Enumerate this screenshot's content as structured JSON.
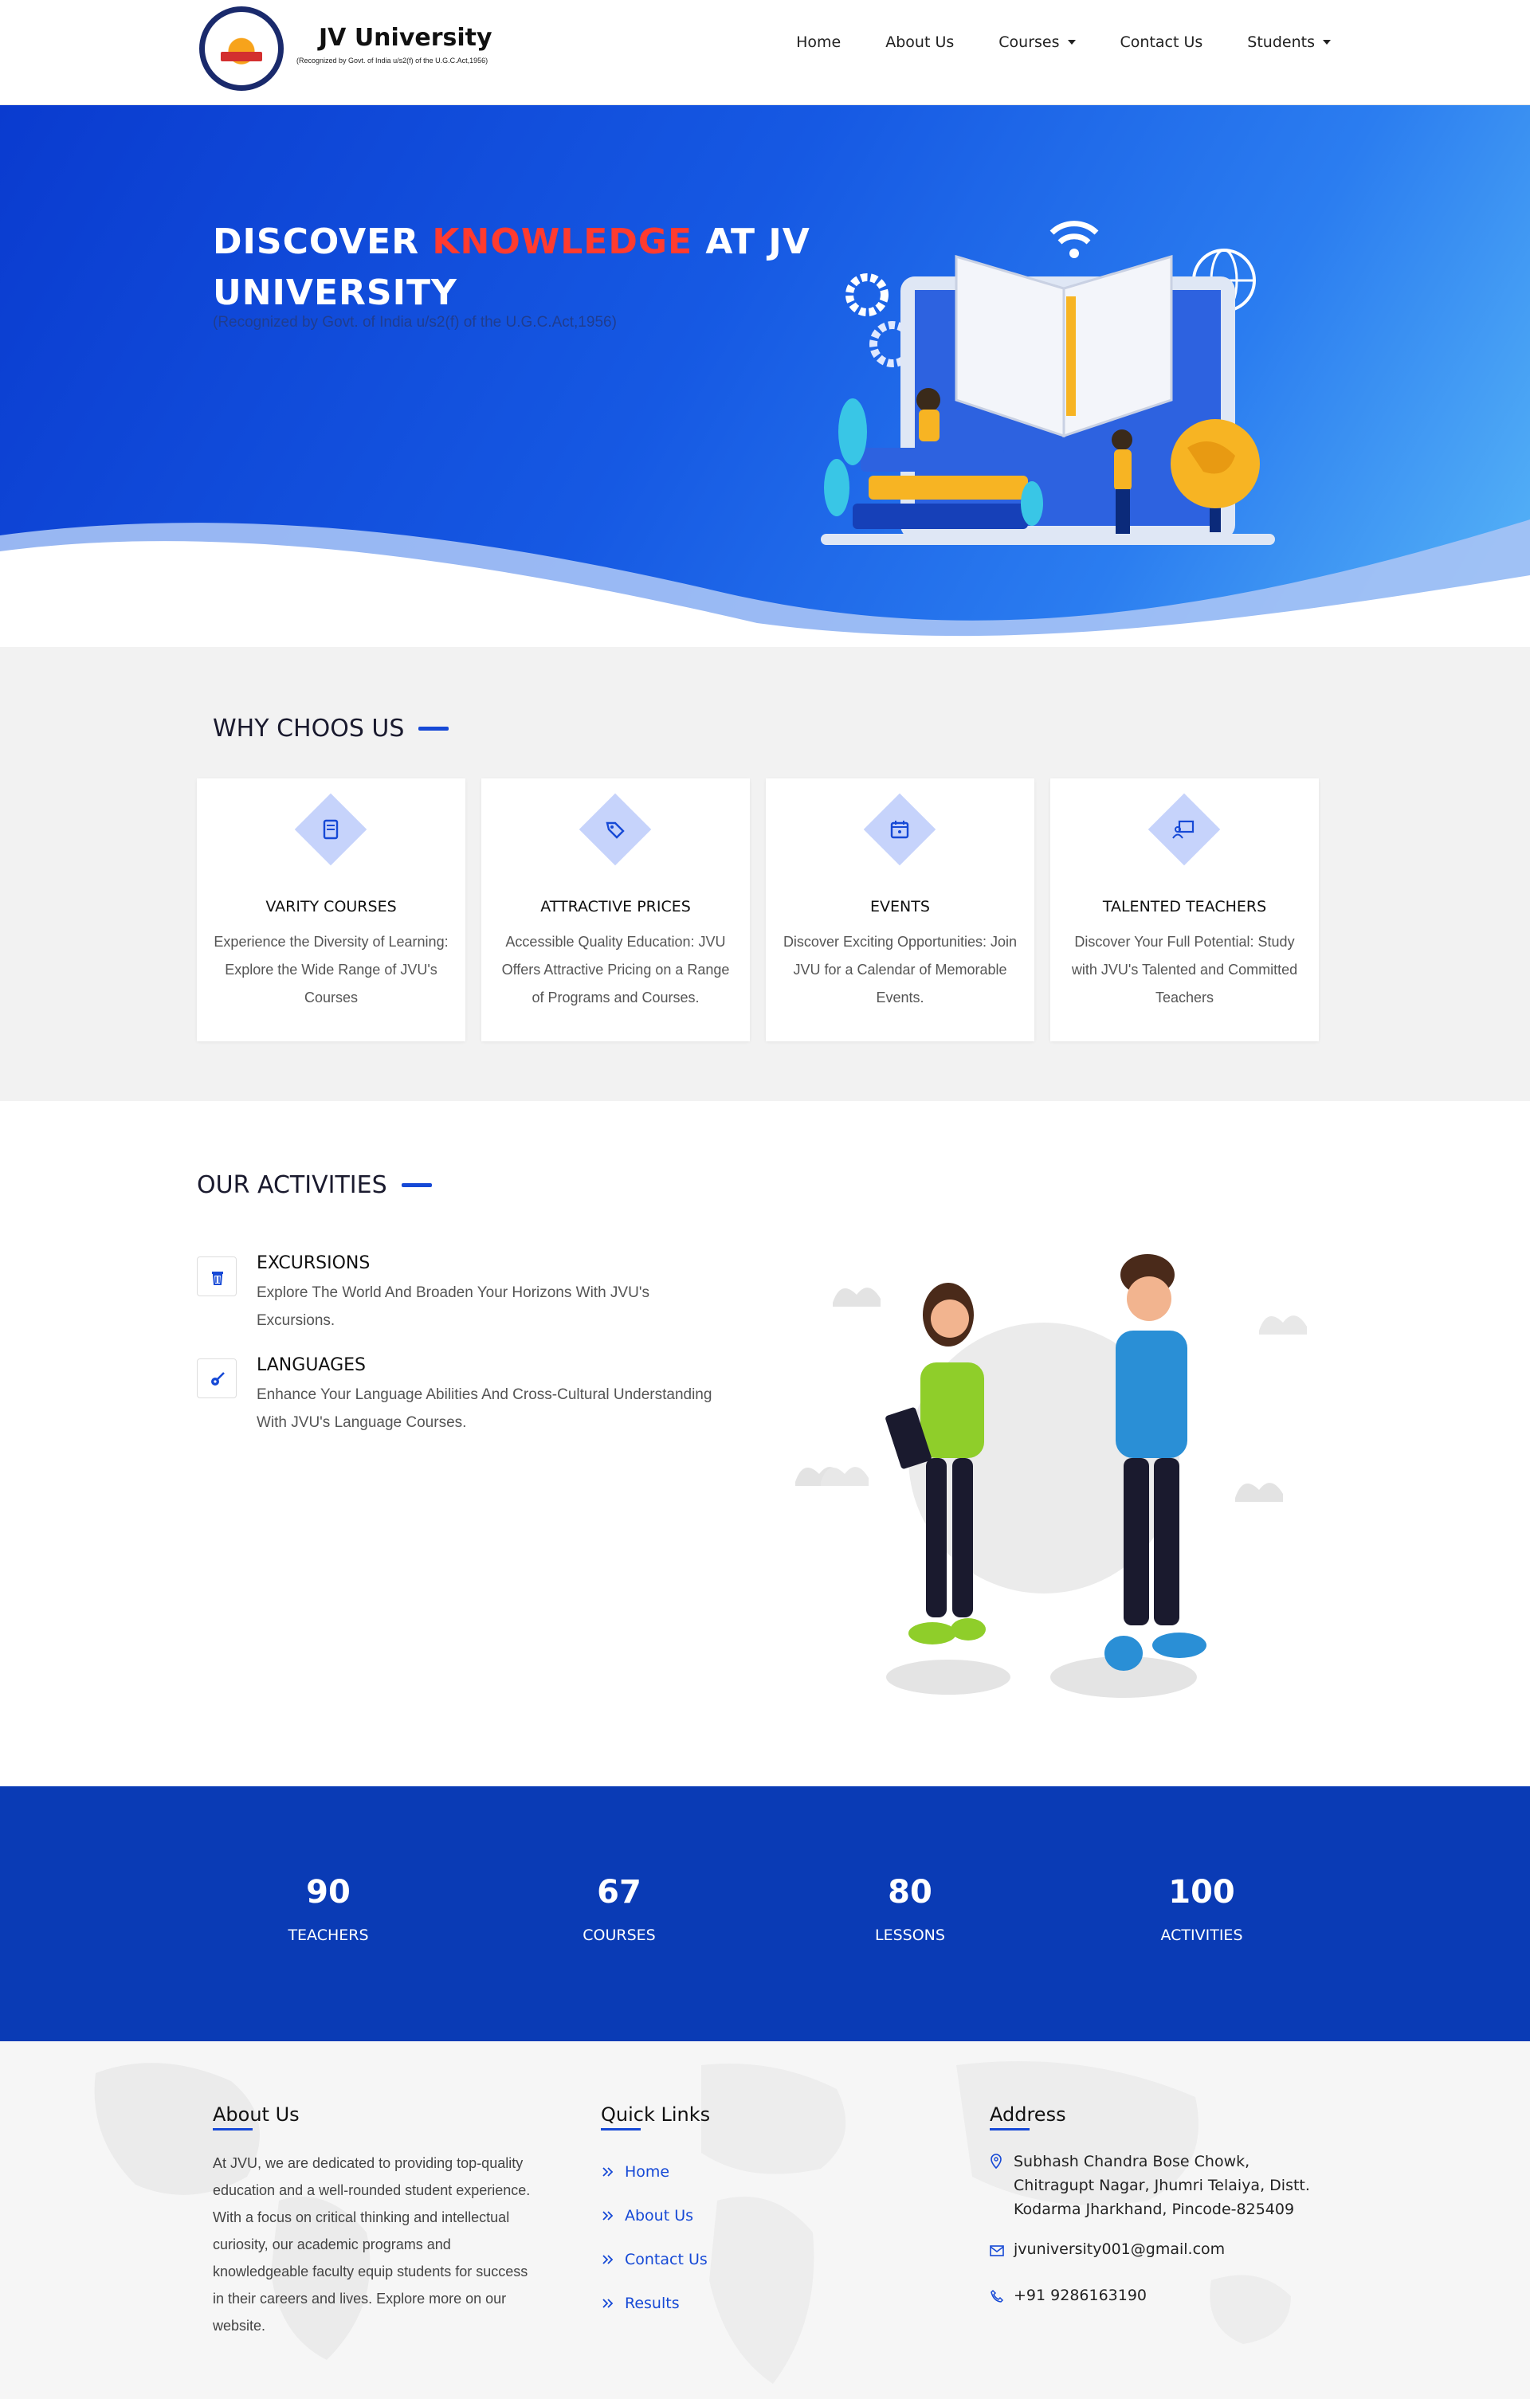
{
  "header": {
    "brand_name": "JV University",
    "brand_sub": "(Recognized by Govt. of India u/s2(f) of the U.G.C.Act,1956)",
    "nav": [
      {
        "label": "Home",
        "dropdown": false
      },
      {
        "label": "About Us",
        "dropdown": false
      },
      {
        "label": "Courses",
        "dropdown": true
      },
      {
        "label": "Contact Us",
        "dropdown": false
      },
      {
        "label": "Students",
        "dropdown": true
      }
    ]
  },
  "hero": {
    "title_part1": "DISCOVER ",
    "title_highlight": "KNOWLEDGE",
    "title_part2": " AT JV UNIVERSITY",
    "tagline": "(Recognized by Govt. of India u/s2(f) of the U.G.C.Act,1956)"
  },
  "why": {
    "title": "WHY CHOOS US",
    "cards": [
      {
        "icon": "book-icon",
        "title": "VARITY COURSES",
        "text": "Experience the Diversity of Learning: Explore the Wide Range of JVU's Courses"
      },
      {
        "icon": "tag-icon",
        "title": "ATTRACTIVE PRICES",
        "text": "Accessible Quality Education: JVU Offers Attractive Pricing on a Range of Programs and Courses."
      },
      {
        "icon": "calendar-icon",
        "title": "EVENTS",
        "text": "Discover Exciting Opportunities: Join JVU for a Calendar of Memorable Events."
      },
      {
        "icon": "teacher-icon",
        "title": "TALENTED TEACHERS",
        "text": "Discover Your Full Potential: Study with JVU's Talented and Committed Teachers"
      }
    ]
  },
  "activities": {
    "title": "OUR ACTIVITIES",
    "items": [
      {
        "icon": "trash-icon",
        "title": "EXCURSIONS",
        "text": "Explore The World And Broaden Your Horizons With JVU's Excursions."
      },
      {
        "icon": "guitar-icon",
        "title": "LANGUAGES",
        "text": "Enhance Your Language Abilities And Cross-Cultural Understanding With JVU's Language Courses."
      }
    ]
  },
  "stats": [
    {
      "value": "90",
      "label": "TEACHERS"
    },
    {
      "value": "67",
      "label": "COURSES"
    },
    {
      "value": "80",
      "label": "LESSONS"
    },
    {
      "value": "100",
      "label": "ACTIVITIES"
    }
  ],
  "footer": {
    "about_title": "About Us",
    "about_text": "At JVU, we are dedicated to providing top-quality education and a well-rounded student experience. With a focus on critical thinking and intellectual curiosity, our academic programs and knowledgeable faculty equip students for success in their careers and lives. Explore more on our website.",
    "links_title": "Quick Links",
    "links": [
      "Home",
      "About Us",
      "Contact Us",
      "Results"
    ],
    "address_title": "Address",
    "address": "Subhash Chandra Bose Chowk, Chitragupt Nagar, Jhumri Telaiya, Distt. Kodarma Jharkhand, Pincode-825409",
    "email": "jvuniversity001@gmail.com",
    "phone": "+91 9286163190"
  },
  "colors": {
    "primary": "#1649d6",
    "highlight": "#ff3b2f",
    "stats_bg": "#0a3bb5"
  }
}
